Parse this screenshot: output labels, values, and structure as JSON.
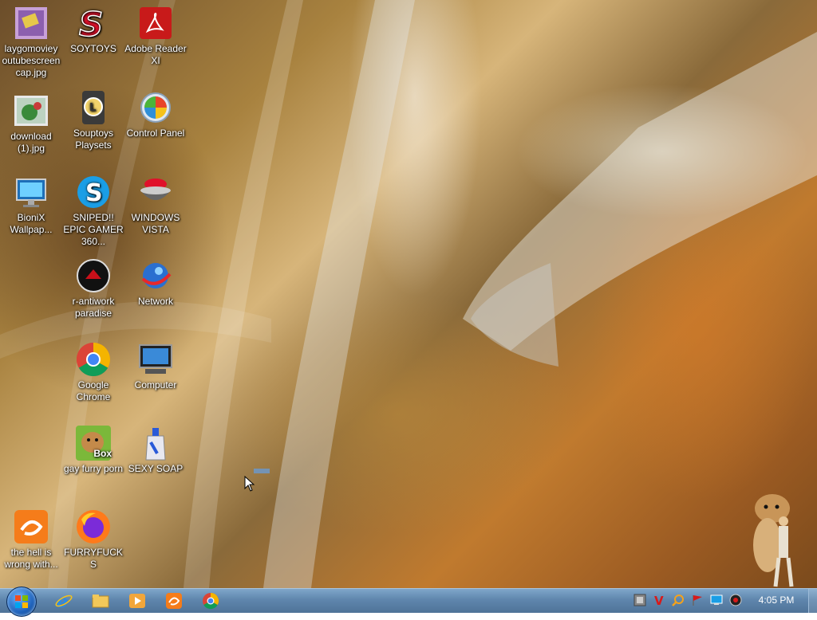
{
  "desktop": {
    "icons": [
      {
        "label": "laygomoviey outubescreen cap.jpg"
      },
      {
        "label": "SOYTOYS"
      },
      {
        "label": "Adobe Reader XI"
      },
      {
        "label": "download (1).jpg"
      },
      {
        "label": "Souptoys Playsets"
      },
      {
        "label": "Control Panel"
      },
      {
        "label": "BioniX Wallpap..."
      },
      {
        "label": "SNIPED!! EPIC GAMER 360..."
      },
      {
        "label": "WINDOWS VISTA"
      },
      {
        "label": "r-antiwork paradise"
      },
      {
        "label": "Network"
      },
      {
        "label": "Google Chrome"
      },
      {
        "label": "Computer"
      },
      {
        "label": "gay furry porn"
      },
      {
        "label": "SEXY SOAP"
      },
      {
        "label": "the hell is wrong with..."
      },
      {
        "label": "FURRYFUCKS"
      }
    ],
    "box_badge": "Box"
  },
  "taskbar": {
    "pinned": [
      {
        "icon": "internet-explorer-icon"
      },
      {
        "icon": "file-explorer-icon"
      },
      {
        "icon": "media-player-icon"
      },
      {
        "icon": "uc-browser-icon"
      },
      {
        "icon": "chrome-icon"
      }
    ],
    "tray": [
      {
        "icon": "tray-app-icon"
      },
      {
        "icon": "v-antivirus-icon"
      },
      {
        "icon": "magnifier-icon"
      },
      {
        "icon": "flag-icon"
      },
      {
        "icon": "display-icon"
      },
      {
        "icon": "volume-icon"
      }
    ],
    "clock": "4:05 PM"
  }
}
